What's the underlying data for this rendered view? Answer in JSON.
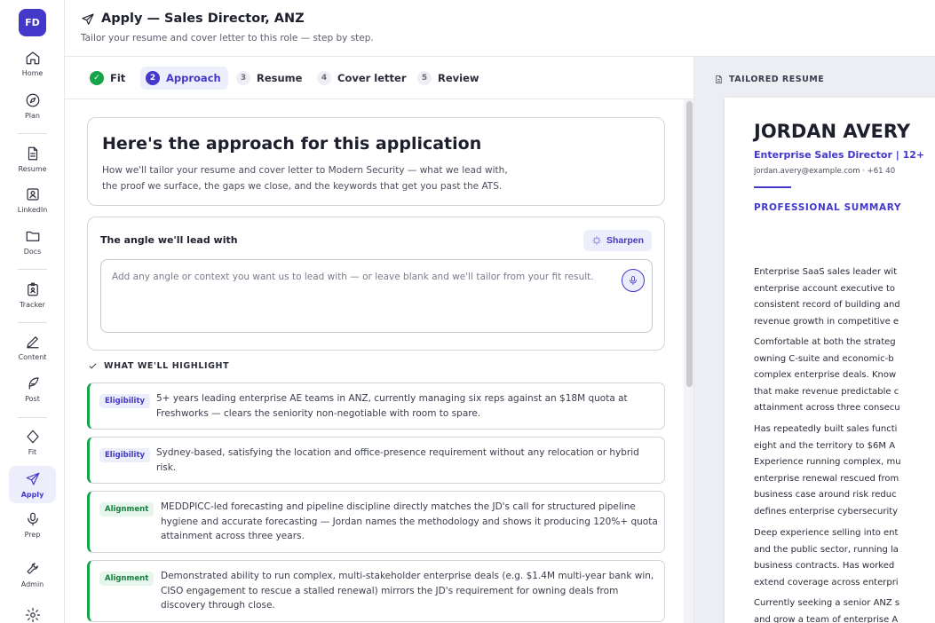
{
  "sidebar": {
    "avatar_initials": "FD",
    "items": [
      {
        "label": "Home",
        "icon": "home-icon"
      },
      {
        "label": "Plan",
        "icon": "compass-icon"
      },
      {
        "label": "Resume",
        "icon": "document-icon"
      },
      {
        "label": "LinkedIn",
        "icon": "profile-card-icon"
      },
      {
        "label": "Docs",
        "icon": "folder-icon"
      },
      {
        "label": "Tracker",
        "icon": "badge-icon"
      },
      {
        "label": "Content",
        "icon": "pen-icon"
      },
      {
        "label": "Post",
        "icon": "feather-icon"
      },
      {
        "label": "Fit",
        "icon": "diamond-icon"
      },
      {
        "label": "Apply",
        "icon": "send-icon"
      },
      {
        "label": "Prep",
        "icon": "mic-icon"
      },
      {
        "label": "Admin",
        "icon": "wrench-icon"
      },
      {
        "label": "",
        "icon": "gear-icon"
      }
    ],
    "active": "Apply"
  },
  "header": {
    "title": "Apply — Sales Director, ANZ",
    "subtitle": "Tailor your resume and cover letter to this role — step by step."
  },
  "steps": [
    {
      "num": "✓",
      "label": "Fit",
      "state": "done"
    },
    {
      "num": "2",
      "label": "Approach",
      "state": "current"
    },
    {
      "num": "3",
      "label": "Resume",
      "state": "upcoming"
    },
    {
      "num": "4",
      "label": "Cover letter",
      "state": "upcoming"
    },
    {
      "num": "5",
      "label": "Review",
      "state": "upcoming"
    }
  ],
  "intro": {
    "title": "Here's the approach for this application",
    "text_line1": "How we'll tailor your resume and cover letter to Modern Security — what we lead with,",
    "text_line2": "the proof we surface, the gaps we close, and the keywords that get you past the ATS."
  },
  "angle": {
    "title": "The angle we'll lead with",
    "sharpen_label": "Sharpen",
    "value": "",
    "placeholder": "Add any angle or context you want us to lead with — or leave blank and we'll tailor from your fit result."
  },
  "highlights": {
    "section_label": "WHAT WE'LL HIGHLIGHT",
    "items": [
      {
        "badge": "Eligibility",
        "kind": "elig",
        "line1": "5+ years leading enterprise AE teams in ANZ, currently managing six reps against an $18M quota at",
        "line2": "Freshworks — clears the seniority non-negotiable with room to spare.",
        "line3": ""
      },
      {
        "badge": "Eligibility",
        "kind": "elig",
        "line1": "Sydney-based, satisfying the location and office-presence requirement without any relocation or hybrid",
        "line2": "risk.",
        "line3": ""
      },
      {
        "badge": "Alignment",
        "kind": "align",
        "line1": "MEDDPICC-led forecasting and pipeline discipline directly matches the JD's call for structured pipeline",
        "line2": "hygiene and accurate forecasting — Jordan names the methodology and shows it producing 120%+ quota",
        "line3": "attainment across three years."
      },
      {
        "badge": "Alignment",
        "kind": "align",
        "line1": "Demonstrated ability to run complex, multi-stakeholder enterprise deals (e.g. $1.4M multi-year bank win,",
        "line2": "CISO engagement to rescue a stalled renewal) mirrors the JD's requirement for owning deals from",
        "line3": "discovery through close."
      }
    ]
  },
  "resume_preview": {
    "label": "TAILORED RESUME",
    "name": "JORDAN AVERY",
    "headline": "Enterprise Sales Director | 12+",
    "contact": "jordan.avery@example.com · +61 40",
    "section": "PROFESSIONAL SUMMARY",
    "paragraphs": [
      [
        "Enterprise SaaS sales leader wit",
        "enterprise account executive to",
        "consistent record of building and",
        "revenue growth in competitive e"
      ],
      [
        "Comfortable at both the strateg",
        "owning C-suite and economic-b",
        "complex enterprise deals. Know",
        "that make revenue predictable c",
        "attainment across three consecu"
      ],
      [
        "Has repeatedly built sales functi",
        "eight and the territory to $6M A",
        "Experience running complex, mu",
        "enterprise renewal rescued from",
        "business case around risk reduc",
        "defines enterprise cybersecurity"
      ],
      [
        "Deep experience selling into ent",
        "and the public sector, running la",
        "business contracts. Has worked",
        "extend coverage across enterpri"
      ],
      [
        "Currently seeking a senior ANZ s",
        "and grow a team of enterprise A"
      ]
    ]
  },
  "colors": {
    "accent": "#4338ca",
    "success": "#16a34a",
    "border": "#d4d5dc"
  }
}
